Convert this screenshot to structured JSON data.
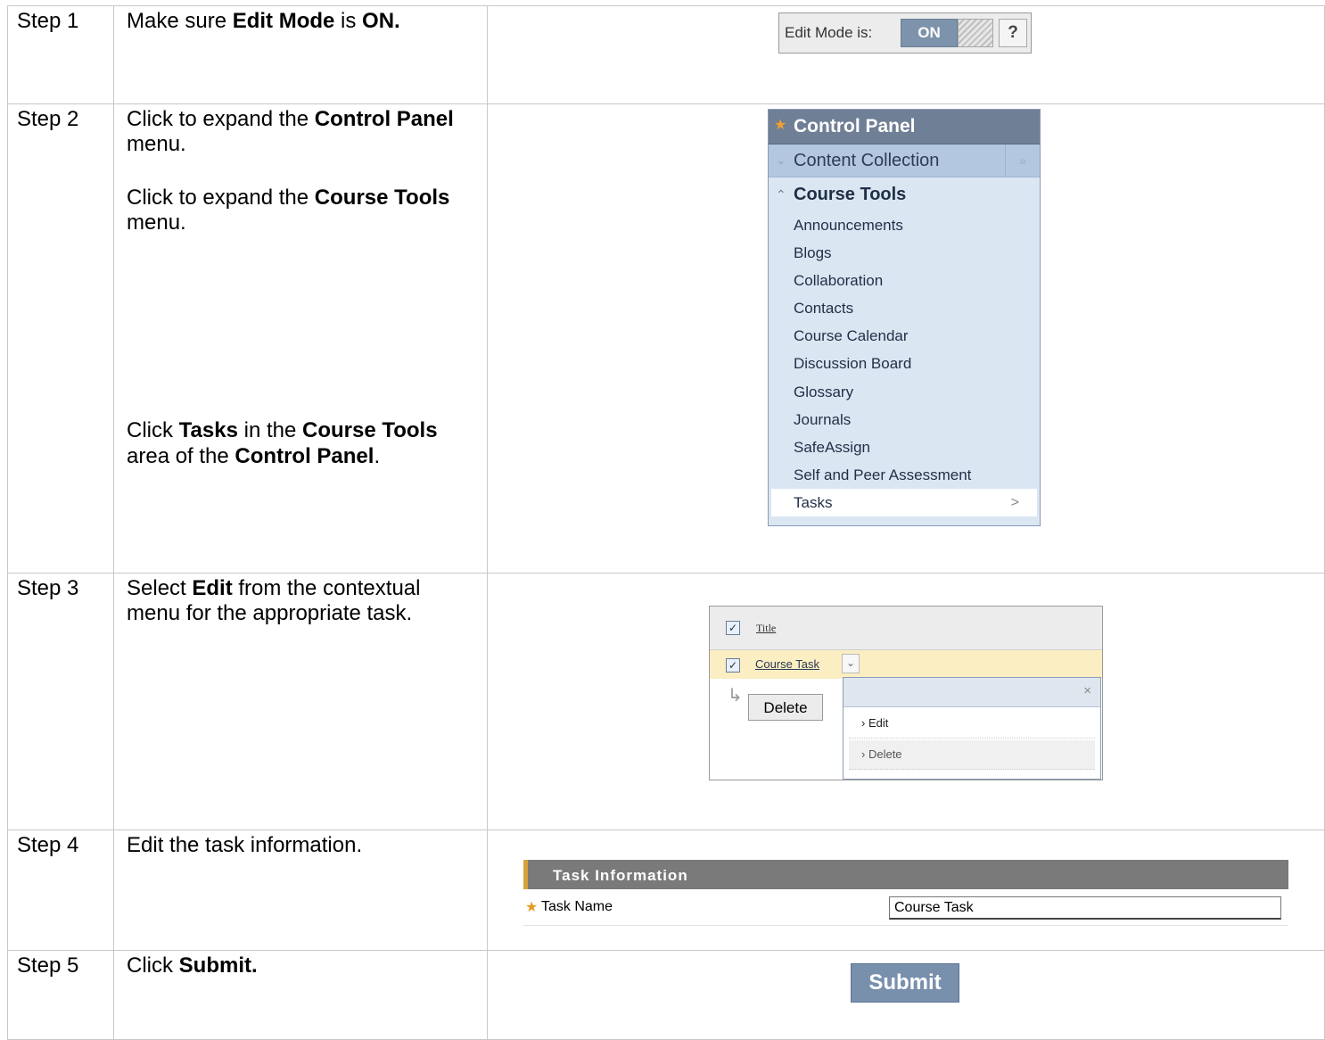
{
  "steps": [
    {
      "label": "Step 1"
    },
    {
      "label": "Step 2"
    },
    {
      "label": "Step 3"
    },
    {
      "label": "Step 4"
    },
    {
      "label": "Step 5"
    }
  ],
  "instructions": {
    "s1": {
      "a": "Make sure ",
      "b": "Edit Mode",
      "c": " is ",
      "d": "ON."
    },
    "s2a": {
      "a": "Click to expand the ",
      "b": "Control Panel",
      "c": " menu."
    },
    "s2b": {
      "a": "Click to expand the ",
      "b": "Course Tools",
      "c": " menu."
    },
    "s2c": {
      "a": "Click ",
      "b": "Tasks",
      "c": " in the ",
      "d": "Course Tools",
      "e": " area of the ",
      "f": "Control Panel",
      "g": "."
    },
    "s3": {
      "a": "Select ",
      "b": "Edit",
      "c": " from the contextual menu for the appropriate task."
    },
    "s4": {
      "a": "Edit the task information."
    },
    "s5": {
      "a": "Click ",
      "b": "Submit."
    }
  },
  "edit_mode": {
    "label": "Edit Mode is:",
    "state": "ON",
    "help": "?"
  },
  "control_panel": {
    "title": "Control Panel",
    "content_collection": "Content Collection",
    "course_tools": "Course Tools",
    "items": [
      "Announcements",
      "Blogs",
      "Collaboration",
      "Contacts",
      "Course Calendar",
      "Discussion Board",
      "Glossary",
      "Journals",
      "SafeAssign",
      "Self and Peer Assessment",
      "Tasks"
    ],
    "selected_arrow": ">"
  },
  "context_menu": {
    "header": "Title",
    "task": "Course Task",
    "delete_button": "Delete",
    "menu_items": [
      "Edit",
      "Delete"
    ]
  },
  "task_info": {
    "section": "Task Information",
    "field_label": "Task Name",
    "field_value": "Course Task"
  },
  "submit": {
    "label": "Submit"
  },
  "colors": {
    "accent": "#7990ad",
    "panel": "#dbe6f3",
    "highlight": "#fbeec2",
    "star": "#e89a20"
  }
}
